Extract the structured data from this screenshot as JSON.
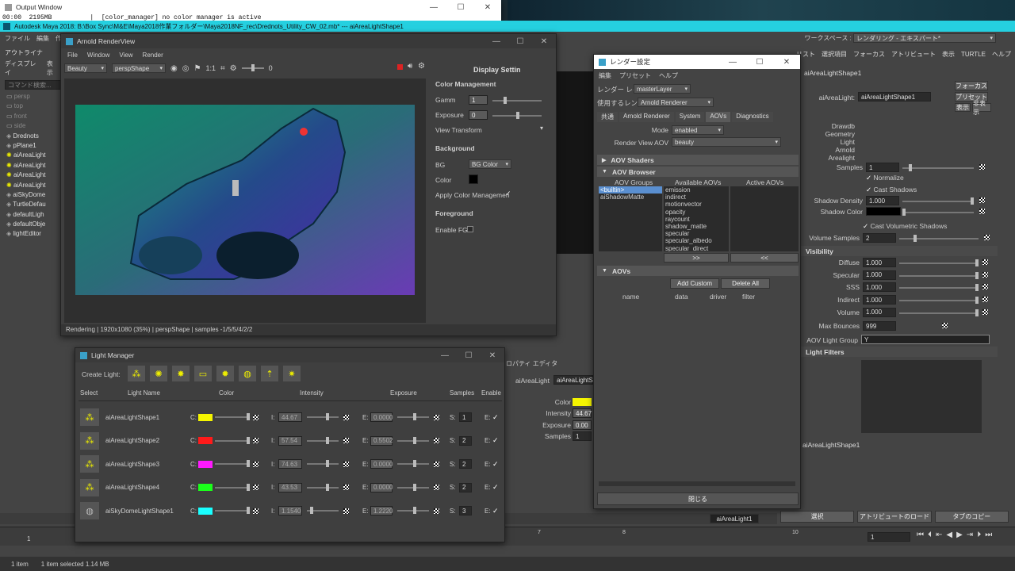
{
  "output": {
    "title": "Output Window",
    "line": "00:00  2195MB          |  [color_manager] no color manager is active"
  },
  "maya": {
    "title": "Autodesk Maya 2018: B:\\Box Sync\\M&E\\Maya2018作業フォルダー\\Maya2018NF_rec\\Drednots_Utility_CW_02.mb*   ---   aiAreaLightShape1",
    "menu_left": [
      "ファイル",
      "編集",
      "作成"
    ],
    "workspace_label": "ワークスペース : ",
    "workspace_value": "レンダリング - エキスパート*",
    "right_menu": [
      "選択項目",
      "フォーカス",
      "アトリビュート",
      "表示",
      "TURTLE",
      "ヘルプ"
    ],
    "right_menu_prefix": "リスト"
  },
  "outliner": {
    "title": "アウトライナ",
    "menu": [
      "ディスプレイ",
      "表示"
    ],
    "search_placeholder": "コマンド検索...",
    "items": [
      "persp",
      "top",
      "front",
      "side",
      "Drednots",
      "pPlane1",
      "aiAreaLight",
      "aiAreaLight",
      "aiAreaLight",
      "aiAreaLight",
      "aiSkyDome",
      "TurtleDefau",
      "defaultLigh",
      "defaultObje",
      "lightEditor"
    ]
  },
  "renderview": {
    "title": "Arnold RenderView",
    "menu": [
      "File",
      "Window",
      "View",
      "Render"
    ],
    "cam1": "Beauty",
    "cam2": "perspShape",
    "ratio": "1:1",
    "exposure": "0",
    "status": "Rendering | 1920x1080 (35%) | perspShape  | samples -1/5/5/4/2/2",
    "side_title": "Display Settin",
    "cm": "Color Management",
    "gamma_label": "Gamm",
    "gamma": "1",
    "exposure_label": "Exposure",
    "exposure_val": "0",
    "view_transform": "View Transform",
    "bg": "Background",
    "bg_label": "BG",
    "bg_value": "BG Color",
    "color_label": "Color",
    "apply_cm": "Apply Color Managemen",
    "fg": "Foreground",
    "enable_fg": "Enable FG"
  },
  "render_settings": {
    "title": "レンダー設定",
    "menu": [
      "編集",
      "プリセット",
      "ヘルプ"
    ],
    "layer_label": "レンダー レイヤ",
    "layer_value": "masterLayer",
    "renderer_label": "使用するレンダラ",
    "renderer_value": "Arnold Renderer",
    "tabs": [
      "共通",
      "Arnold Renderer",
      "System",
      "AOVs",
      "Diagnostics"
    ],
    "mode_label": "Mode",
    "mode_value": "enabled",
    "rv_label": "Render View AOV",
    "rv_value": "beauty",
    "aov_shaders": "AOV Shaders",
    "aov_browser": "AOV Browser",
    "col_groups": "AOV Groups",
    "col_available": "Available AOVs",
    "col_active": "Active AOVs",
    "groups": [
      "<builtin>",
      "aiShadowMatte"
    ],
    "available": [
      "emission",
      "indirect",
      "motionvector",
      "opacity",
      "raycount",
      "shadow_matte",
      "specular",
      "specular_albedo",
      "specular_direct"
    ],
    "add_btn": ">>",
    "remove_btn": "<<",
    "aovs": "AOVs",
    "add_custom": "Add Custom",
    "delete_all": "Delete All",
    "cols": [
      "name",
      "data",
      "driver",
      "filter"
    ],
    "close": "閉じる"
  },
  "attr": {
    "header": "aiAreaLightShape1",
    "node_label": "aiAreaLight:",
    "node_value": "aiAreaLightShape1",
    "focus": "フォーカス",
    "preset": "プリセット",
    "show": "表示",
    "hide": "非表示",
    "notes": [
      "Drawdb",
      "Geometry",
      "Light",
      "Arnold",
      "Arealight"
    ],
    "samples_label": "Samples",
    "samples": "1",
    "normalize": "Normalize",
    "cast_shadows": "Cast Shadows",
    "shadow_density_label": "Shadow Density",
    "shadow_density": "1.000",
    "shadow_color_label": "Shadow Color",
    "cast_vol": "Cast Volumetric Shadows",
    "vol_samples_label": "Volume Samples",
    "vol_samples": "2",
    "visibility": "Visibility",
    "vis": [
      {
        "label": "Diffuse",
        "value": "1.000"
      },
      {
        "label": "Specular",
        "value": "1.000"
      },
      {
        "label": "SSS",
        "value": "1.000"
      },
      {
        "label": "Indirect",
        "value": "1.000"
      },
      {
        "label": "Volume",
        "value": "1.000"
      }
    ],
    "max_bounces_label": "Max Bounces",
    "max_bounces": "999",
    "aov_group_label": "AOV Light Group",
    "aov_group": "Y",
    "light_filters": "Light Filters",
    "footer_name": "aiAreaLightShape1",
    "btn_select": "選択",
    "btn_load": "アトリビュートのロード",
    "btn_copy": "タブのコピー"
  },
  "prop": {
    "title": "ロパティ エディタ",
    "name_label": "aiAreaLight",
    "name_value": "aiAreaLightS",
    "color_label": "Color",
    "intensity_label": "Intensity",
    "intensity": "44.67",
    "exposure_label": "Exposure",
    "exposure": "0.00",
    "samples_label": "Samples",
    "samples": "1"
  },
  "lightmgr": {
    "title": "Light Manager",
    "create": "Create Light:",
    "cols": [
      "Select",
      "Light Name",
      "Color",
      "Intensity",
      "Exposure",
      "Samples",
      "Enable"
    ],
    "rows": [
      {
        "name": "aiAreaLightShape1",
        "color": "#f5f500",
        "i": "44.67",
        "e": "0.0000",
        "s": "1"
      },
      {
        "name": "aiAreaLightShape2",
        "color": "#ff1a1a",
        "i": "57.54",
        "e": "0.5502",
        "s": "2"
      },
      {
        "name": "aiAreaLightShape3",
        "color": "#ff1aff",
        "i": "74.63",
        "e": "0.0000",
        "s": "2"
      },
      {
        "name": "aiAreaLightShape4",
        "color": "#1aff1a",
        "i": "43.53",
        "e": "0.0000",
        "s": "2"
      },
      {
        "name": "aiSkyDomeLightShape1",
        "color": "#1affff",
        "i": "1.1540",
        "e": "1.2220",
        "s": "3"
      }
    ],
    "c": "C:",
    "ilab": "I:",
    "elab": "E:",
    "slab": "S:",
    "enlab": "E:"
  },
  "timeline": {
    "ticks": [
      "1",
      "7",
      "8",
      "10"
    ],
    "frame": "1",
    "key": "1",
    "range_name": "aiAreaLight1"
  },
  "statusbar": {
    "a": "1 item",
    "b": "1 item selected  1.14 MB"
  }
}
